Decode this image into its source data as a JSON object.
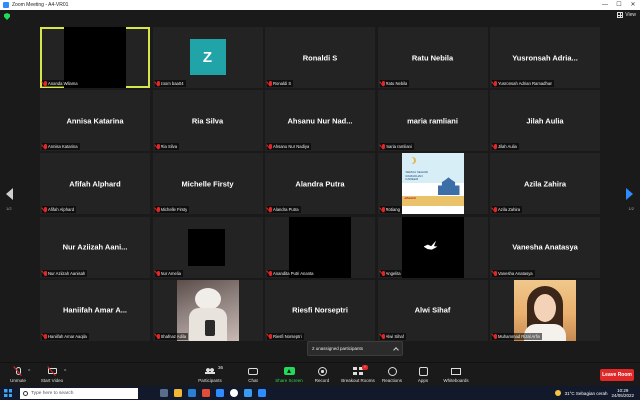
{
  "window": {
    "title": "Zoom Meeting - A4-VR01",
    "controls": [
      "—",
      "☐",
      "✕"
    ]
  },
  "view": {
    "label": "View"
  },
  "pager": {
    "left": "1/2",
    "right": "1/2"
  },
  "tiles": [
    {
      "display": "",
      "tag": "Ananda Wilama",
      "type": "video-black",
      "active": true
    },
    {
      "display": "",
      "tag": "zoom baa04",
      "type": "avatar",
      "avatar_letter": "Z"
    },
    {
      "display": "Ronaldi S",
      "tag": "Ronaldi S",
      "type": "name"
    },
    {
      "display": "Ratu Nebila",
      "tag": "Ratu Nebila",
      "type": "name"
    },
    {
      "display": "Yusronsah Adria...",
      "tag": "Yusronsah Adrian Ramadhan",
      "type": "name"
    },
    {
      "display": "Annisa Katarina",
      "tag": "Annisa Katarina",
      "type": "name"
    },
    {
      "display": "Ria Silva",
      "tag": "Ria Silva",
      "type": "name"
    },
    {
      "display": "Ahsanu Nur Nad...",
      "tag": "Ahsanu Nur Nadiya",
      "type": "name"
    },
    {
      "display": "maria ramliani",
      "tag": "maria ramliani",
      "type": "name"
    },
    {
      "display": "Jilah Aulia",
      "tag": "Jilah Aulia",
      "type": "name"
    },
    {
      "display": "Afifah Alphard",
      "tag": "Afifah Alphard",
      "type": "name"
    },
    {
      "display": "Michelle Firsty",
      "tag": "Michelle Firsty",
      "type": "name"
    },
    {
      "display": "Alandra Putra",
      "tag": "Alandra Putra",
      "type": "name"
    },
    {
      "display": "",
      "tag": "Rotiang",
      "type": "poster",
      "poster_text": "SEMUA SEHARI RAMADHAN KAREEM",
      "poster_logo": "alfamidi"
    },
    {
      "display": "Azila Zahira",
      "tag": "Azila Zahira",
      "type": "name"
    },
    {
      "display": "Nur Aziizah Aani...",
      "tag": "Nur Aziizah Aanisah",
      "type": "name"
    },
    {
      "display": "",
      "tag": "Nur Amelia",
      "type": "video-black-small"
    },
    {
      "display": "",
      "tag": "Anandita Putri Ananta",
      "type": "video-black"
    },
    {
      "display": "",
      "tag": "Angelita",
      "type": "dove"
    },
    {
      "display": "Vanesha Anatasya",
      "tag": "Vanesha Anatasya",
      "type": "name"
    },
    {
      "display": "Haniifah Amar A...",
      "tag": "Haniifah Amar Aaqila",
      "type": "name"
    },
    {
      "display": "",
      "tag": "Shafnaz Adila",
      "type": "photo-shafnaz"
    },
    {
      "display": "Riesfi Norseptri",
      "tag": "Riesfi Norseptri",
      "type": "name"
    },
    {
      "display": "Alwi Sihaf",
      "tag": "Alwi Sihaf",
      "type": "name"
    },
    {
      "display": "",
      "tag": "Muhammad Rizal Arfin",
      "type": "photo-muh"
    }
  ],
  "toast": {
    "message": "2 unassigned participants"
  },
  "toolbar": {
    "unmute": "Unmute",
    "start_video": "Start Video",
    "participants": "Participants",
    "participants_count": "36",
    "chat": "Chat",
    "share_screen": "Share Screen",
    "record": "Record",
    "breakout_rooms": "Breakout Rooms",
    "reactions": "Reactions",
    "apps": "Apps",
    "whiteboards": "Whiteboards",
    "leave": "Leave Room"
  },
  "taskbar": {
    "search_placeholder": "Type here to search",
    "weather": "31°C  Sebagian cerah",
    "time": "10:29",
    "date": "24/05/2022",
    "app_colors": [
      "#5a6d8a",
      "#f2b632",
      "#2a7fd4",
      "#e44c3a",
      "#2d8cff",
      "#ffffff",
      "#3a9cf0",
      "#2d8cff"
    ]
  },
  "colors": {
    "accent": "#2d8cff",
    "active_speaker": "#d6e64b",
    "muted": "#e02828",
    "share": "#23d959",
    "leave": "#e02828"
  }
}
